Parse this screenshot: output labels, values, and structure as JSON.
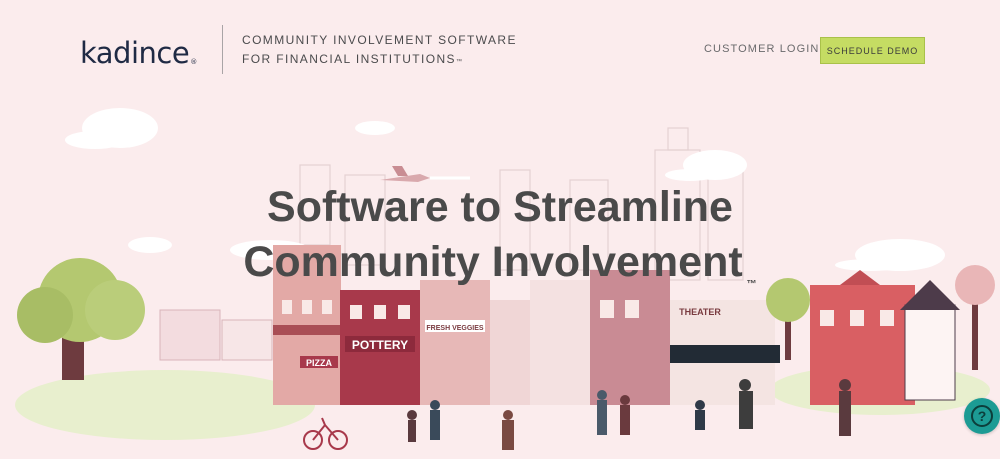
{
  "brand": {
    "name": "kadince",
    "reg": "®"
  },
  "header": {
    "tagline_line1": "COMMUNITY INVOLVEMENT SOFTWARE",
    "tagline_line2": "FOR FINANCIAL INSTITUTIONS",
    "tagline_mark": "™",
    "login_label": "CUSTOMER LOGIN",
    "demo_label": "SCHEDULE DEMO"
  },
  "hero": {
    "title_line1": "Software to Streamline",
    "title_line2": "Community Involvement",
    "title_mark": "™"
  },
  "illustration": {
    "sign_pizza": "PIZZA",
    "sign_pottery": "POTTERY",
    "sign_veggies": "FRESH VEGGIES",
    "sign_theater": "THEATER"
  },
  "help_widget": {
    "icon": "question-icon",
    "glyph": "?"
  },
  "colors": {
    "background": "#fbeced",
    "cta": "#c5dc63",
    "help": "#1c9b94",
    "text": "#4a4a4a"
  }
}
